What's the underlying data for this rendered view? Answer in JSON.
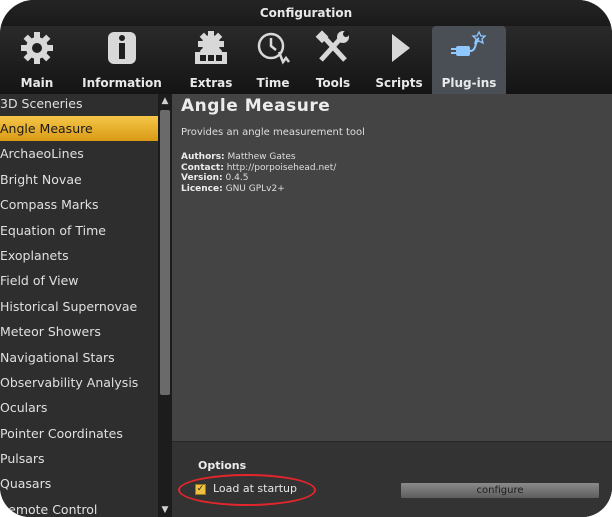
{
  "window": {
    "title": "Configuration"
  },
  "toolbar": {
    "tabs": [
      {
        "label": "Main",
        "icon": "gear-icon"
      },
      {
        "label": "Information",
        "icon": "info-icon"
      },
      {
        "label": "Extras",
        "icon": "extras-gear-icon"
      },
      {
        "label": "Time",
        "icon": "clock-icon"
      },
      {
        "label": "Tools",
        "icon": "tools-icon"
      },
      {
        "label": "Scripts",
        "icon": "play-icon"
      },
      {
        "label": "Plug-ins",
        "icon": "plug-icon"
      }
    ],
    "active_tab": "Plug-ins"
  },
  "sidebar": {
    "items": [
      "3D Sceneries",
      "Angle Measure",
      "ArchaeoLines",
      "Bright Novae",
      "Compass Marks",
      "Equation of Time",
      "Exoplanets",
      "Field of View",
      "Historical Supernovae",
      "Meteor Showers",
      "Navigational Stars",
      "Observability Analysis",
      "Oculars",
      "Pointer Coordinates",
      "Pulsars",
      "Quasars",
      "Remote Control"
    ],
    "selected": "Angle Measure"
  },
  "plugin": {
    "title": "Angle Measure",
    "description": "Provides an angle measurement tool",
    "authors_label": "Authors:",
    "authors": "Matthew Gates",
    "contact_label": "Contact:",
    "contact": "http://porpoisehead.net/",
    "version_label": "Version:",
    "version": "0.4.5",
    "licence_label": "Licence:",
    "licence": "GNU GPLv2+"
  },
  "options": {
    "title": "Options",
    "load_at_startup_label": "Load at startup",
    "load_at_startup_checked": true,
    "configure_label": "configure"
  },
  "colors": {
    "selection": "#f5c648",
    "annotation_ring": "#e3262b",
    "active_tab": "#4a4f56"
  }
}
